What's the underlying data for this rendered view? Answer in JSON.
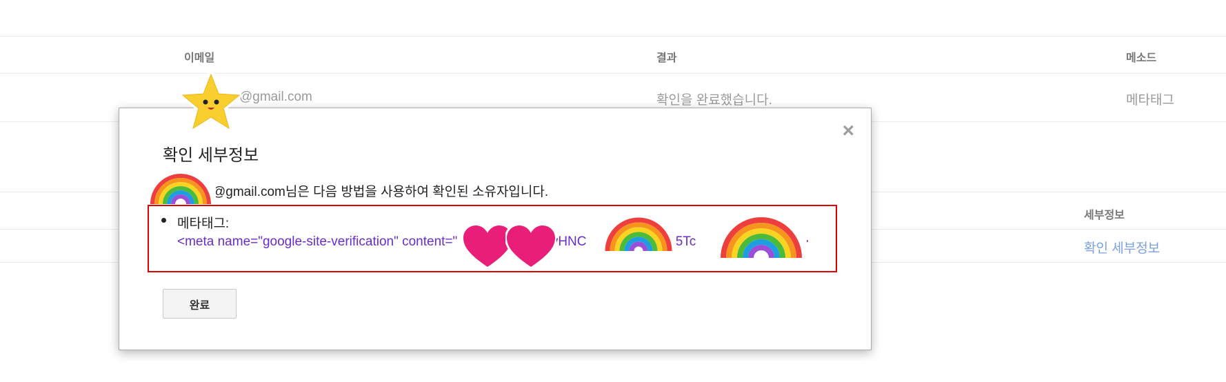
{
  "table": {
    "header": {
      "email": "이메일",
      "result": "결과",
      "method": "메소드"
    },
    "row": {
      "email": "@gmail.com",
      "result": "확인을 완료했습니다.",
      "method": "메타태그"
    },
    "header2": {
      "details": "세부정보"
    },
    "row2": {
      "details_link": "확인 세부정보"
    }
  },
  "dialog": {
    "title": "확인 세부정보",
    "close_symbol": "×",
    "owner_email_fragment": "@gmail.com",
    "owner_text": "님은 다음 방법을 사용하여 확인된 소유자입니다.",
    "method_label": "메타태그:",
    "meta_tag": {
      "prefix": "<meta name=\"google-site-verification\" content=\"",
      "fragment1": "1vHNC",
      "fragment2": "0A5Tc",
      "suffix": "\" />"
    },
    "done_label": "완료"
  },
  "colors": {
    "accent_link": "#7a9fe0",
    "meta_text": "#6a2ccb",
    "highlight_border": "#e00000",
    "header_text": "#777777"
  },
  "icons": {
    "close": "close-icon",
    "bullet": "bullet-icon",
    "stickers": [
      "star-sticker-icon",
      "rainbow-sticker-icon",
      "heart-sticker-icon"
    ]
  }
}
